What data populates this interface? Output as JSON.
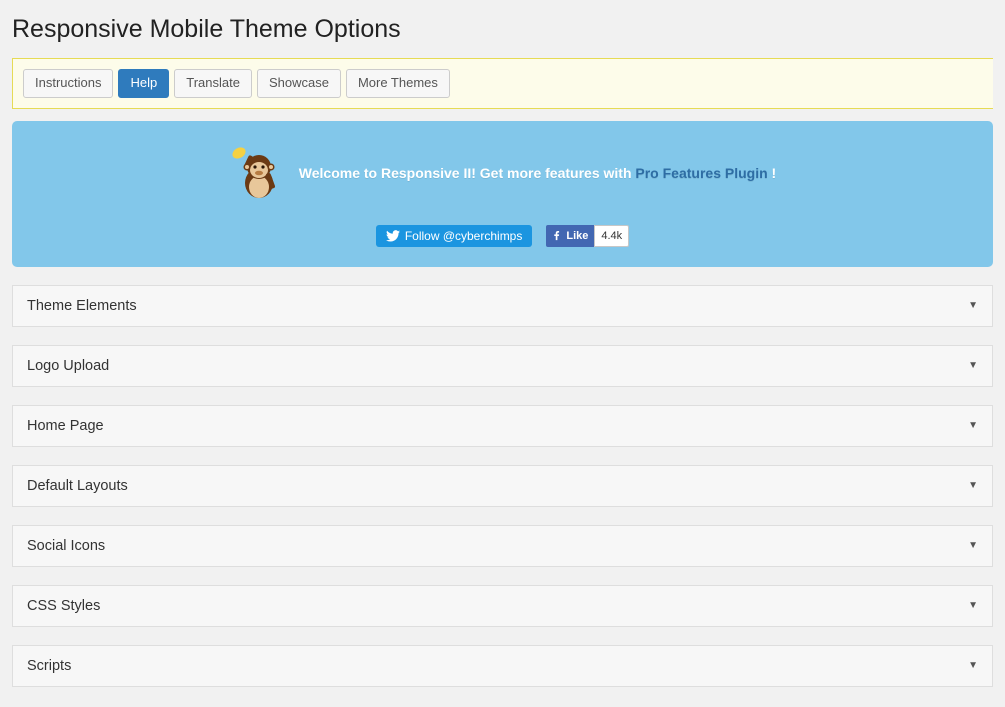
{
  "page_title": "Responsive Mobile Theme Options",
  "tabs": {
    "instructions": "Instructions",
    "help": "Help",
    "translate": "Translate",
    "showcase": "Showcase",
    "more_themes": "More Themes"
  },
  "welcome": {
    "text_a": "Welcome to Responsive II! Get more features with ",
    "link_text": "Pro Features Plugin",
    "text_b": " !"
  },
  "social": {
    "twitter_label": "Follow @cyberchimps",
    "fb_like_label": "Like",
    "fb_count": "4.4k"
  },
  "accordion": {
    "theme_elements": "Theme Elements",
    "logo_upload": "Logo Upload",
    "home_page": "Home Page",
    "default_layouts": "Default Layouts",
    "social_icons": "Social Icons",
    "css_styles": "CSS Styles",
    "scripts": "Scripts"
  }
}
